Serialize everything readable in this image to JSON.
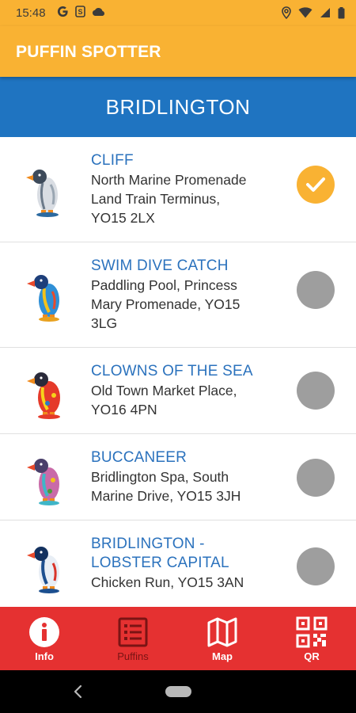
{
  "status_bar": {
    "time": "15:48"
  },
  "app_bar": {
    "title": "PUFFIN SPOTTER"
  },
  "location": {
    "title": "BRIDLINGTON"
  },
  "puffins": [
    {
      "name": "CLIFF",
      "address_lines": [
        "North Marine Promenade",
        "Land Train Terminus,",
        "YO15 2LX"
      ],
      "found": true
    },
    {
      "name": "SWIM DIVE CATCH",
      "address_lines": [
        "Paddling Pool, Princess",
        "Mary Promenade, YO15",
        "3LG"
      ],
      "found": false
    },
    {
      "name": "CLOWNS OF THE SEA",
      "address_lines": [
        "Old Town Market Place,",
        "YO16 4PN"
      ],
      "found": false
    },
    {
      "name": "BUCCANEER",
      "address_lines": [
        "Bridlington Spa, South",
        "Marine Drive, YO15 3JH"
      ],
      "found": false
    },
    {
      "name_lines": [
        "BRIDLINGTON -",
        "LOBSTER CAPITAL"
      ],
      "address_lines": [
        "Chicken Run, YO15 3AN"
      ],
      "found": false
    }
  ],
  "bottom_nav": {
    "items": [
      {
        "label": "Info",
        "icon": "info-icon",
        "active": true
      },
      {
        "label": "Puffins",
        "icon": "list-icon",
        "active": false
      },
      {
        "label": "Map",
        "icon": "map-icon",
        "active": true
      },
      {
        "label": "QR",
        "icon": "qr-code-icon",
        "active": true
      }
    ]
  },
  "colors": {
    "app_bar": "#f9b233",
    "location_header": "#1f74c1",
    "bottom_nav": "#e53131",
    "item_title": "#2b72bd",
    "found_badge": "#f9b233",
    "not_found_badge": "#9e9e9e"
  }
}
